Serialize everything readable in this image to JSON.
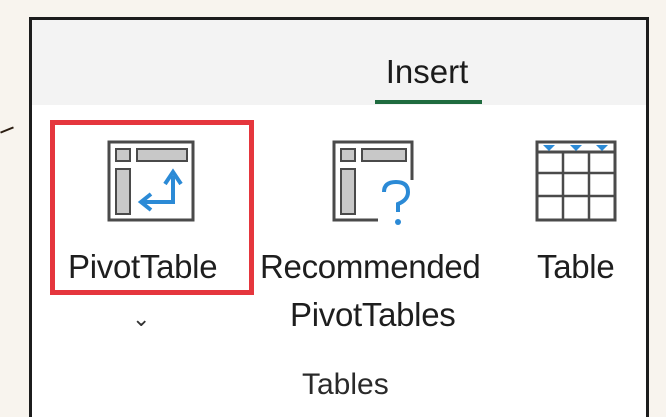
{
  "ribbon": {
    "active_tab": "Insert",
    "group_label": "Tables",
    "buttons": [
      {
        "label": "PivotTable",
        "dropdown_glyph": "⌄",
        "icon": "pivottable-icon"
      },
      {
        "label_line1": "Recommended",
        "label_line2": "PivotTables",
        "icon": "recommended-pivottables-icon"
      },
      {
        "label": "Table",
        "icon": "table-icon"
      }
    ]
  },
  "colors": {
    "highlight": "#e5363d",
    "tab_underline": "#1f6b3f",
    "icon_blue": "#2b8ad6",
    "icon_gray": "#c8c8c8",
    "background": "#f8f4ee"
  }
}
